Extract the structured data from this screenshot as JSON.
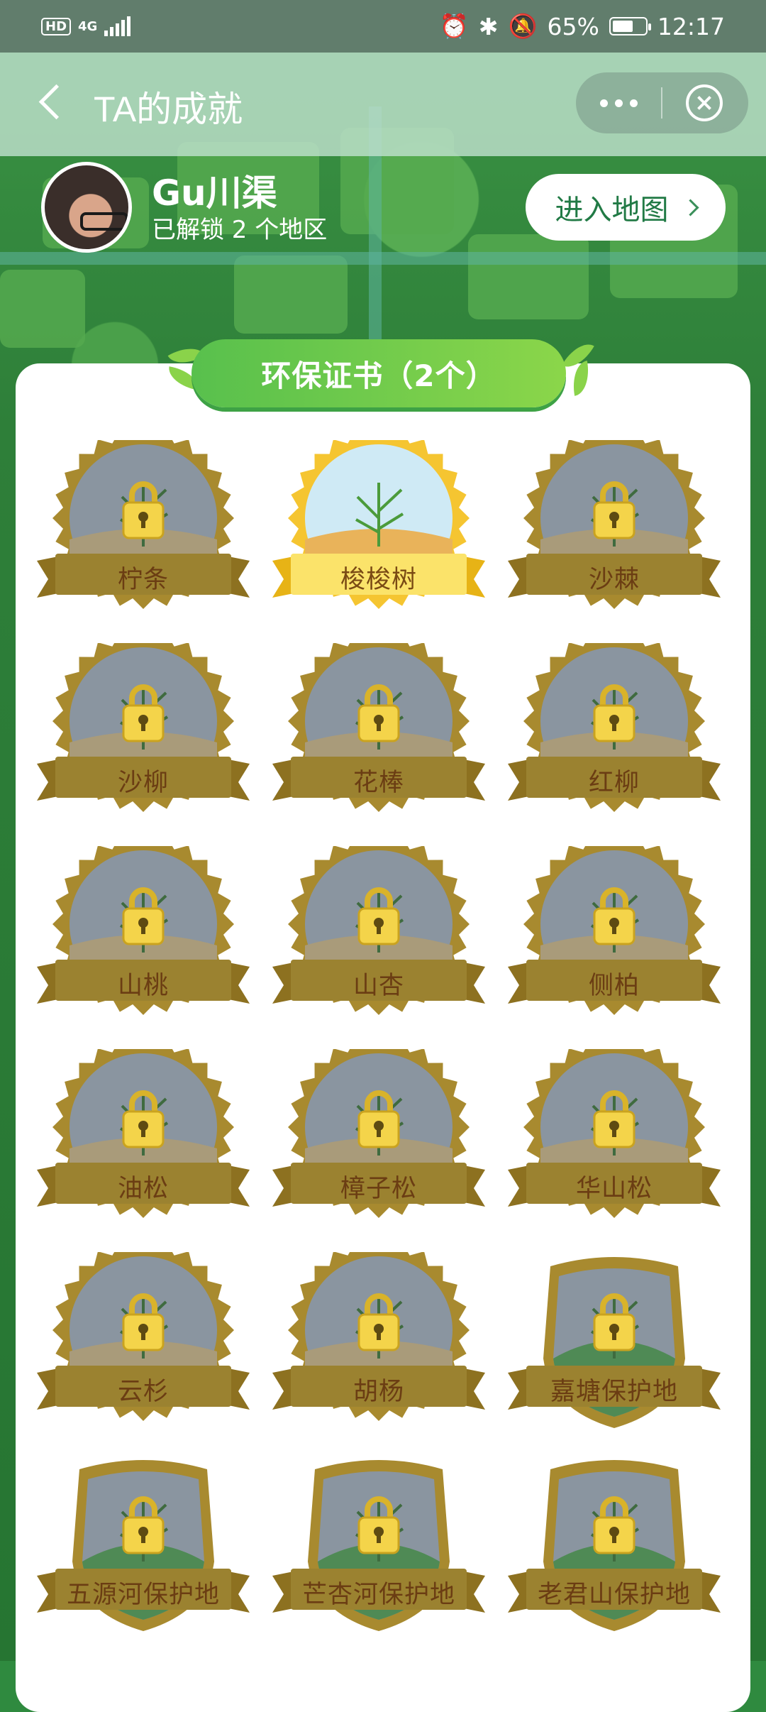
{
  "status_bar": {
    "network": "4G",
    "hd_label": "HD",
    "battery_text": "65%",
    "battery_level": 0.65,
    "time": "12:17"
  },
  "navbar": {
    "title": "TA的成就"
  },
  "profile": {
    "name": "Gu川渠",
    "unlock_text": "已解锁 2 个地区",
    "map_button": "进入地图"
  },
  "certificates": {
    "title": "环保证书（2个）",
    "items": [
      {
        "label": "柠条",
        "locked": true,
        "shape": "seal",
        "icon": "plant-icon"
      },
      {
        "label": "梭梭树",
        "locked": false,
        "shape": "seal",
        "icon": "plant-icon"
      },
      {
        "label": "沙棘",
        "locked": true,
        "shape": "seal",
        "icon": "plant-icon"
      },
      {
        "label": "沙柳",
        "locked": true,
        "shape": "seal",
        "icon": "plant-icon"
      },
      {
        "label": "花棒",
        "locked": true,
        "shape": "seal",
        "icon": "plant-icon"
      },
      {
        "label": "红柳",
        "locked": true,
        "shape": "seal",
        "icon": "plant-icon"
      },
      {
        "label": "山桃",
        "locked": true,
        "shape": "seal",
        "icon": "tree-icon"
      },
      {
        "label": "山杏",
        "locked": true,
        "shape": "seal",
        "icon": "tree-icon"
      },
      {
        "label": "侧柏",
        "locked": true,
        "shape": "seal",
        "icon": "tree-icon"
      },
      {
        "label": "油松",
        "locked": true,
        "shape": "seal",
        "icon": "tree-icon"
      },
      {
        "label": "樟子松",
        "locked": true,
        "shape": "seal",
        "icon": "tree-icon"
      },
      {
        "label": "华山松",
        "locked": true,
        "shape": "seal",
        "icon": "tree-icon"
      },
      {
        "label": "云杉",
        "locked": true,
        "shape": "seal",
        "icon": "tree-icon"
      },
      {
        "label": "胡杨",
        "locked": true,
        "shape": "seal",
        "icon": "tree-icon"
      },
      {
        "label": "嘉塘保护地",
        "locked": true,
        "shape": "shield",
        "icon": "landscape-icon"
      },
      {
        "label": "五源河保护地",
        "locked": true,
        "shape": "shield",
        "icon": "landscape-icon"
      },
      {
        "label": "芒杏河保护地",
        "locked": true,
        "shape": "shield",
        "icon": "landscape-icon"
      },
      {
        "label": "老君山保护地",
        "locked": true,
        "shape": "shield",
        "icon": "landscape-icon"
      }
    ]
  },
  "colors": {
    "accent_green": "#58c04d",
    "badge_gold": "#a88a2f",
    "badge_gold_unlocked": "#f5c531",
    "lock_yellow": "#f4d44a"
  }
}
